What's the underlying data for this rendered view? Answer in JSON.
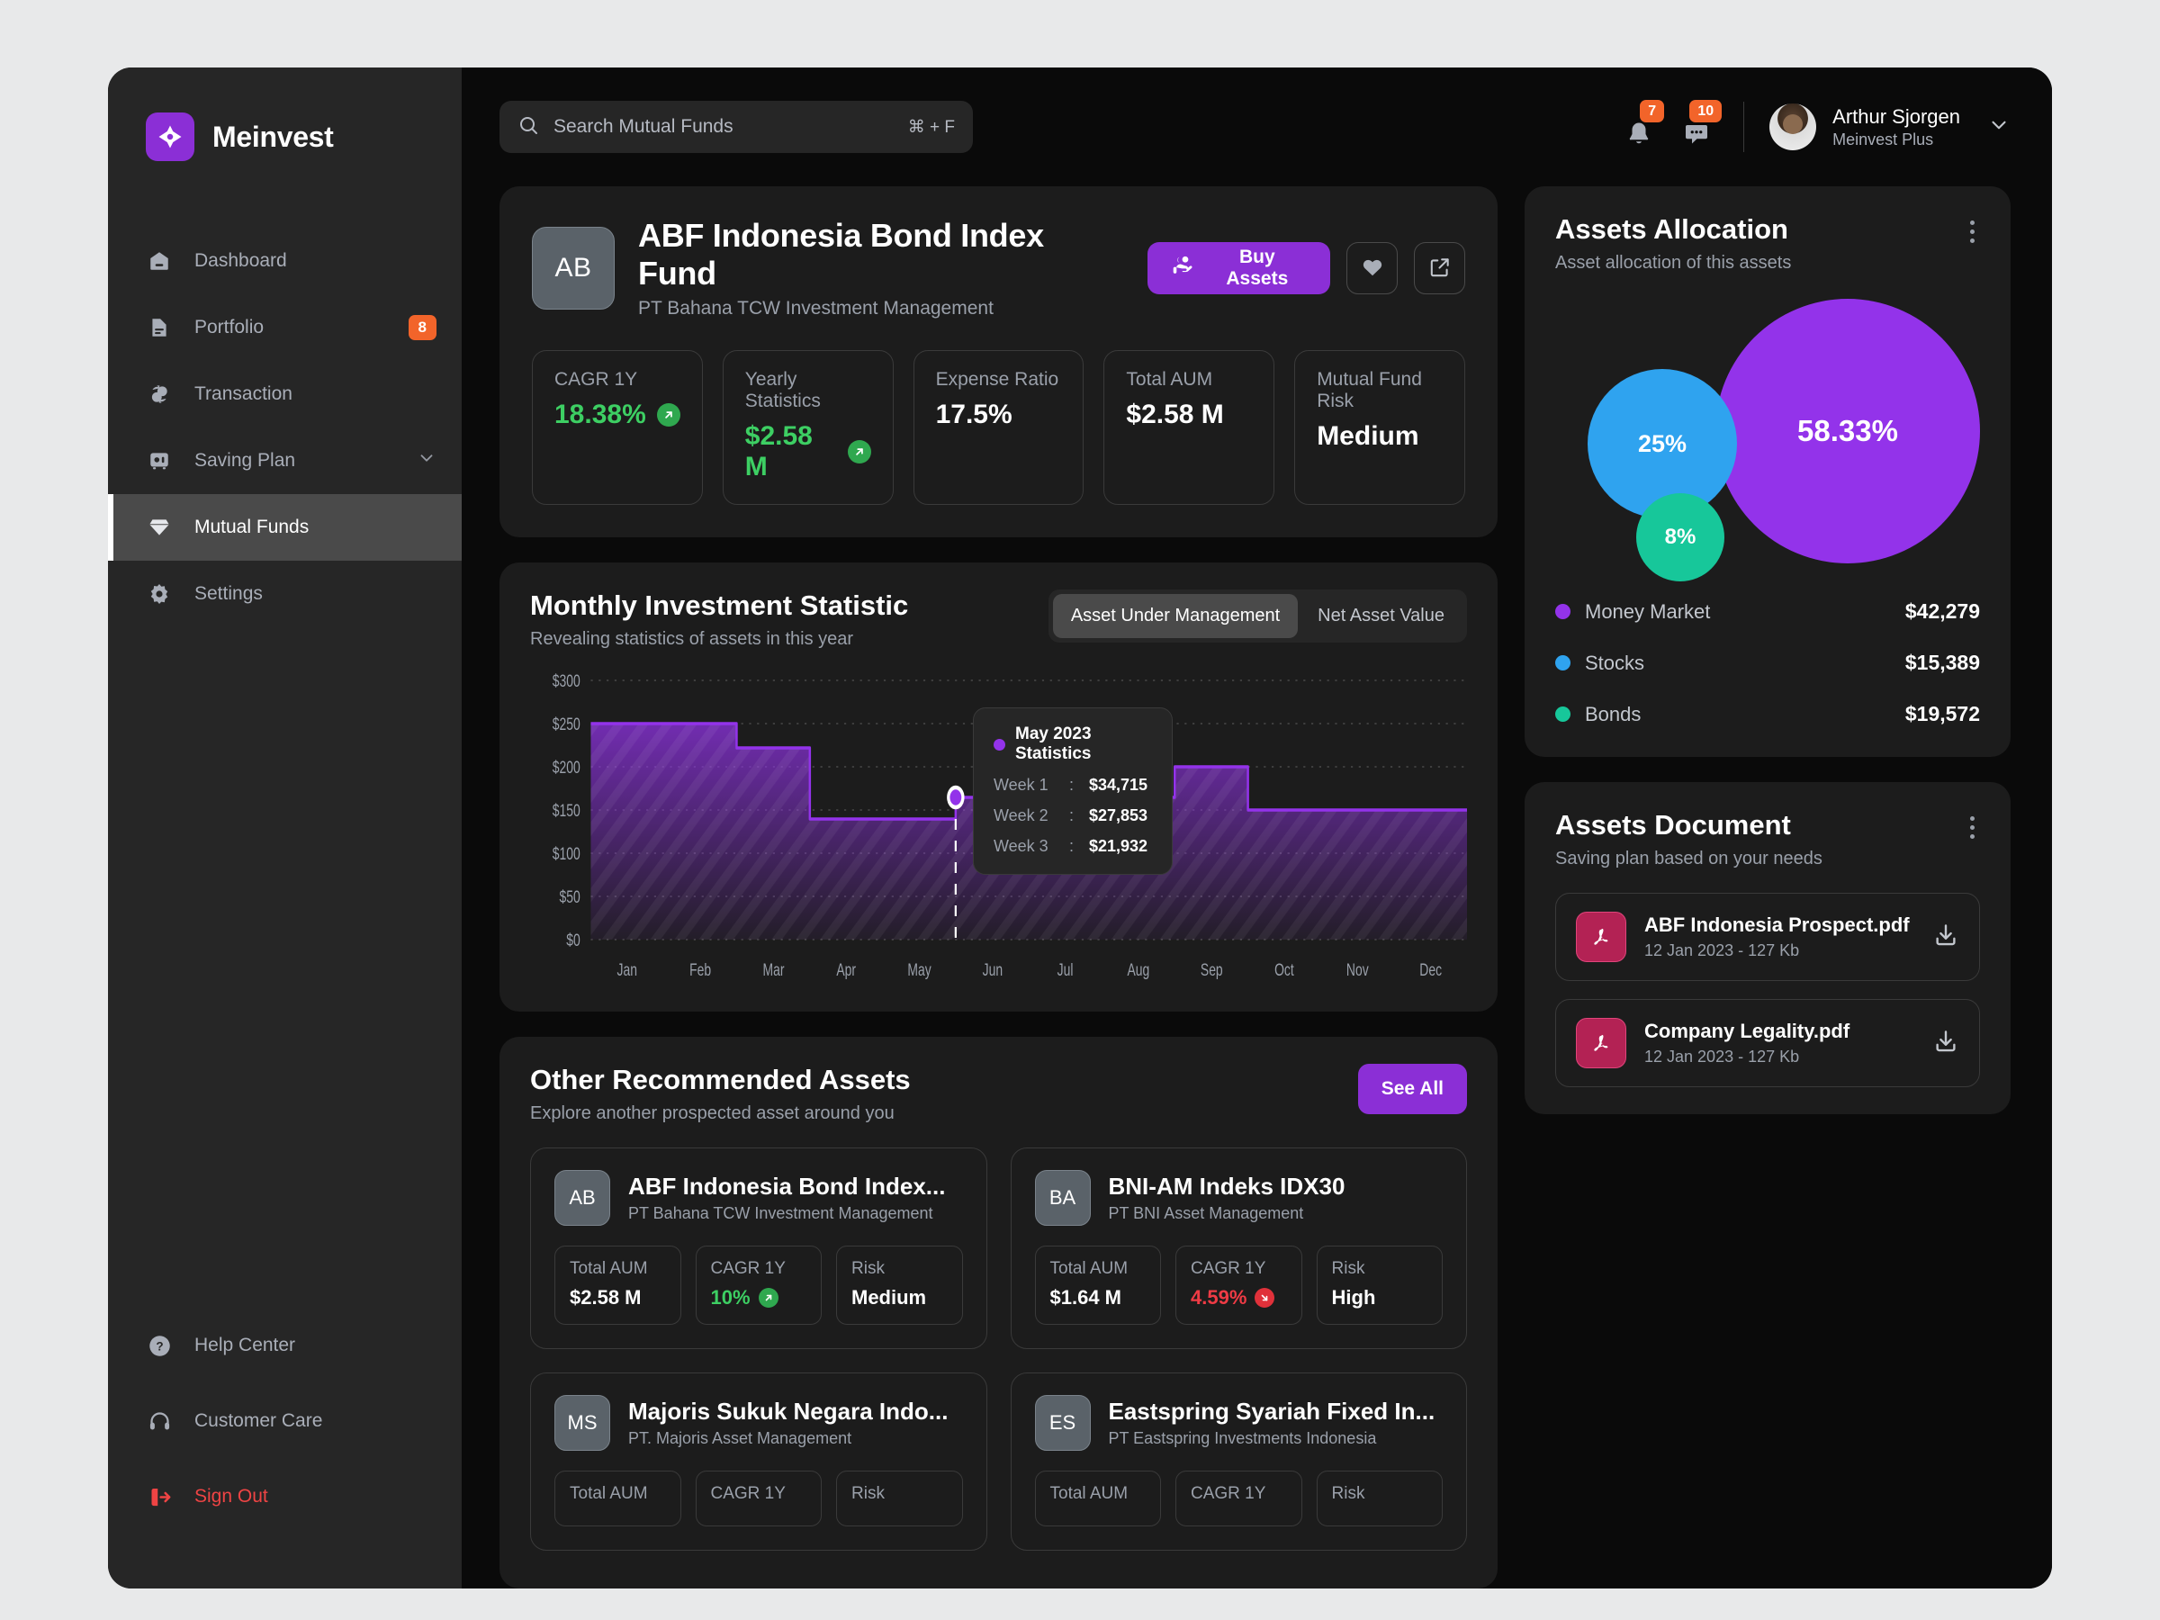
{
  "brand": {
    "name": "Meinvest",
    "logo_icon": "diamond-logo-icon",
    "accent": "#8b2fd6"
  },
  "sidebar": {
    "items": [
      {
        "label": "Dashboard",
        "icon": "home-icon",
        "badge": null,
        "active": false,
        "chevron": false
      },
      {
        "label": "Portfolio",
        "icon": "document-icon",
        "badge": "8",
        "active": false,
        "chevron": false
      },
      {
        "label": "Transaction",
        "icon": "exchange-icon",
        "badge": null,
        "active": false,
        "chevron": false
      },
      {
        "label": "Saving Plan",
        "icon": "safe-box-icon",
        "badge": null,
        "active": false,
        "chevron": true
      },
      {
        "label": "Mutual Funds",
        "icon": "diamond-icon",
        "badge": null,
        "active": true,
        "chevron": false
      },
      {
        "label": "Settings",
        "icon": "gear-icon",
        "badge": null,
        "active": false,
        "chevron": false
      }
    ],
    "footer": [
      {
        "label": "Help Center",
        "icon": "question-circle-icon",
        "danger": false
      },
      {
        "label": "Customer Care",
        "icon": "headset-icon",
        "danger": false
      },
      {
        "label": "Sign Out",
        "icon": "sign-out-icon",
        "danger": true
      }
    ],
    "badge_color": "#f2642a"
  },
  "topbar": {
    "search": {
      "placeholder": "Search Mutual Funds",
      "value": "",
      "shortcut": "⌘ + F",
      "icon": "search-icon"
    },
    "notifications": {
      "icon": "bell-icon",
      "count": "7"
    },
    "messages": {
      "icon": "chat-icon",
      "count": "10"
    },
    "user": {
      "name": "Arthur Sjorgen",
      "plan": "Meinvest Plus",
      "avatar": "avatar",
      "chevron": "chevron-down-icon"
    }
  },
  "hero": {
    "initials": "AB",
    "title": "ABF Indonesia Bond Index Fund",
    "manager": "PT Bahana TCW Investment Management",
    "buy_label": "Buy Assets",
    "buy_icon": "buy-assets-icon",
    "favorite_icon": "heart-icon",
    "share_icon": "external-link-icon",
    "stats": [
      {
        "label": "CAGR 1Y",
        "value": "18.38%",
        "tone": "green",
        "trend": "up"
      },
      {
        "label": "Yearly Statistics",
        "value": "$2.58 M",
        "tone": "green",
        "trend": "up"
      },
      {
        "label": "Expense Ratio",
        "value": "17.5%",
        "tone": "white",
        "trend": null
      },
      {
        "label": "Total AUM",
        "value": "$2.58 M",
        "tone": "white",
        "trend": null
      },
      {
        "label": "Mutual Fund Risk",
        "value": "Medium",
        "tone": "white",
        "trend": null
      }
    ]
  },
  "chart_panel": {
    "title": "Monthly Investment Statistic",
    "subtitle": "Revealing statistics of assets in this year",
    "tabs": [
      {
        "label": "Asset Under Management",
        "active": true
      },
      {
        "label": "Net Asset Value",
        "active": false
      }
    ],
    "tooltip": {
      "title": "May 2023 Statistics",
      "rows": [
        {
          "key": "Week 1",
          "sep": ":",
          "value": "$34,715"
        },
        {
          "key": "Week 2",
          "sep": ":",
          "value": "$27,853"
        },
        {
          "key": "Week 3",
          "sep": ":",
          "value": "$21,932"
        }
      ]
    }
  },
  "chart_data": {
    "type": "area",
    "title": "Monthly Investment Statistic",
    "subtitle": "Revealing statistics of assets in this year",
    "xlabel": "",
    "ylabel": "",
    "step": "step-post",
    "categories": [
      "Jan",
      "Feb",
      "Mar",
      "Apr",
      "May",
      "Jun",
      "Jul",
      "Aug",
      "Sep",
      "Oct",
      "Nov",
      "Dec"
    ],
    "series": [
      {
        "name": "Asset Under Management",
        "color": "#9333ea",
        "values": [
          250,
          250,
          222,
          140,
          140,
          165,
          165,
          165,
          165,
          200,
          150,
          150
        ]
      }
    ],
    "ytick_labels": [
      "$300",
      "$250",
      "$200",
      "$150",
      "$100",
      "$50",
      "$0"
    ],
    "ytick_values": [
      300,
      250,
      200,
      150,
      100,
      50,
      0
    ],
    "ylim": [
      0,
      300
    ],
    "grid": true,
    "legend": false,
    "highlight": {
      "month": "May",
      "value": 165
    }
  },
  "recommended": {
    "title": "Other Recommended Assets",
    "subtitle": "Explore another prospected asset around you",
    "see_all": "See All",
    "stat_labels": {
      "aum": "Total AUM",
      "cagr": "CAGR 1Y",
      "risk": "Risk"
    },
    "items": [
      {
        "initials": "AB",
        "name": "ABF Indonesia Bond Index...",
        "manager": "PT Bahana TCW Investment Management",
        "aum": "$2.58 M",
        "cagr": "10%",
        "cagr_tone": "green",
        "trend": "up",
        "risk": "Medium"
      },
      {
        "initials": "BA",
        "name": "BNI-AM Indeks IDX30",
        "manager": "PT BNI Asset Management",
        "aum": "$1.64 M",
        "cagr": "4.59%",
        "cagr_tone": "red",
        "trend": "down",
        "risk": "High"
      },
      {
        "initials": "MS",
        "name": "Majoris Sukuk Negara Indo...",
        "manager": "PT. Majoris Asset Management",
        "aum": "",
        "cagr": "",
        "cagr_tone": "green",
        "trend": null,
        "risk": ""
      },
      {
        "initials": "ES",
        "name": "Eastspring Syariah Fixed In...",
        "manager": "PT Eastspring Investments Indonesia",
        "aum": "",
        "cagr": "",
        "cagr_tone": "green",
        "trend": null,
        "risk": ""
      }
    ]
  },
  "allocation": {
    "title": "Assets Allocation",
    "subtitle": "Asset allocation of this assets",
    "menu_icon": "kebab-menu-icon",
    "bubbles": [
      {
        "label": "58.33%",
        "color": "#9333ea"
      },
      {
        "label": "25%",
        "color": "#2fa3ef"
      },
      {
        "label": "8%",
        "color": "#17c79a"
      }
    ],
    "legend": [
      {
        "name": "Money Market",
        "value": "$42,279",
        "color": "#9333ea"
      },
      {
        "name": "Stocks",
        "value": "$15,389",
        "color": "#2fa3ef"
      },
      {
        "name": "Bonds",
        "value": "$19,572",
        "color": "#17c79a"
      }
    ]
  },
  "documents": {
    "title": "Assets Document",
    "subtitle": "Saving plan based on your needs",
    "menu_icon": "kebab-menu-icon",
    "items": [
      {
        "name": "ABF Indonesia Prospect.pdf",
        "meta": "12 Jan 2023 - 127 Kb",
        "icon": "pdf-icon",
        "download": "download-icon"
      },
      {
        "name": "Company Legality.pdf",
        "meta": "12 Jan 2023 - 127 Kb",
        "icon": "pdf-icon",
        "download": "download-icon"
      }
    ]
  }
}
